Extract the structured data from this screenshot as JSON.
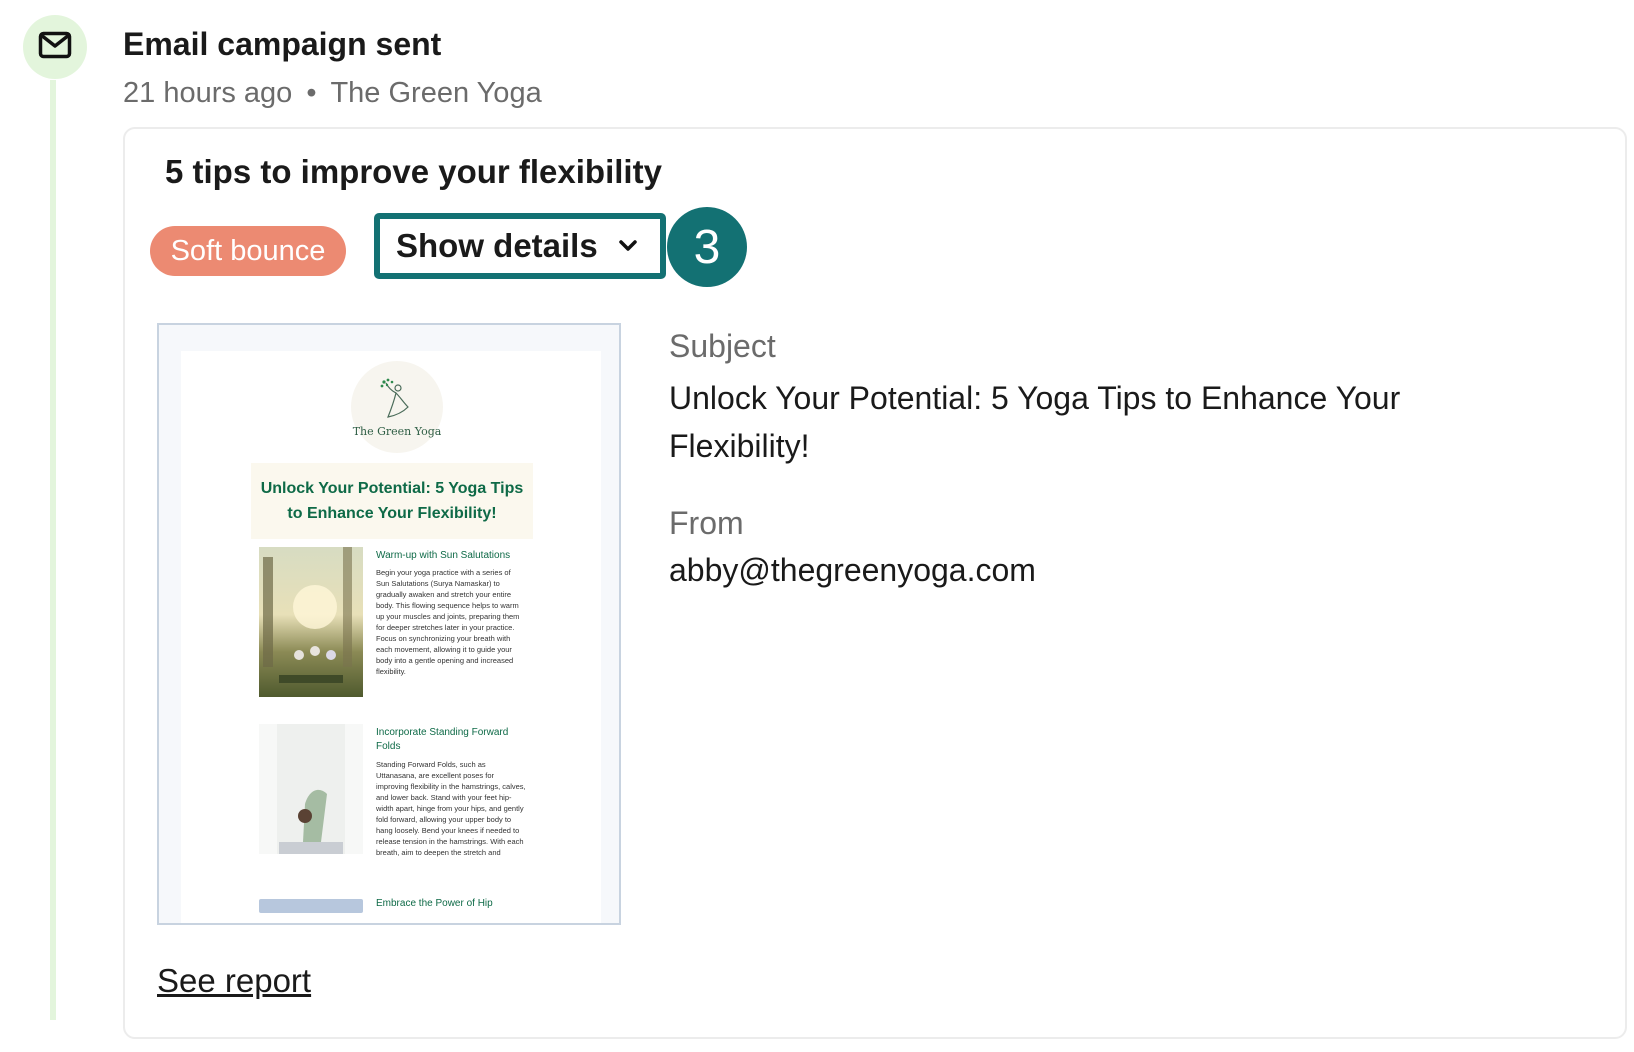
{
  "event": {
    "title": "Email campaign sent",
    "time": "21 hours ago",
    "separator": "•",
    "account": "The Green Yoga",
    "icon": "mail-icon"
  },
  "campaign": {
    "name": "5 tips to improve your flexibility",
    "status": "Soft bounce",
    "show_details_label": "Show details",
    "step_number": "3",
    "see_report_label": "See report"
  },
  "details": {
    "subject_label": "Subject",
    "subject_value": "Unlock Your Potential: 5 Yoga Tips to Enhance Your Flexibility!",
    "from_label": "From",
    "from_value": "abby@thegreenyoga.com"
  },
  "preview": {
    "logo_text": "The Green Yoga",
    "headline": "Unlock Your Potential: 5 Yoga Tips to Enhance Your Flexibility!",
    "articles": [
      {
        "title": "Warm-up with Sun Salutations",
        "body": "Begin your yoga practice with a series of Sun Salutations (Surya Namaskar) to gradually awaken and stretch your entire body. This flowing sequence helps to warm up your muscles and joints, preparing them for deeper stretches later in your practice. Focus on synchronizing your breath with each movement, allowing it to guide your body into a gentle opening and increased flexibility."
      },
      {
        "title": "Incorporate Standing Forward Folds",
        "body": "Standing Forward Folds, such as Uttanasana, are excellent poses for improving flexibility in the hamstrings, calves, and lower back. Stand with your feet hip-width apart, hinge from your hips, and gently fold forward, allowing your upper body to hang loosely. Bend your knees if needed to release tension in the hamstrings. With each breath, aim to deepen the stretch and"
      },
      {
        "title": "Embrace the Power of Hip",
        "body": ""
      }
    ]
  },
  "colors": {
    "accent": "#137173",
    "timeline": "#e3f5dc",
    "badge": "#ec8a72",
    "preview_green": "#0e6a47"
  }
}
